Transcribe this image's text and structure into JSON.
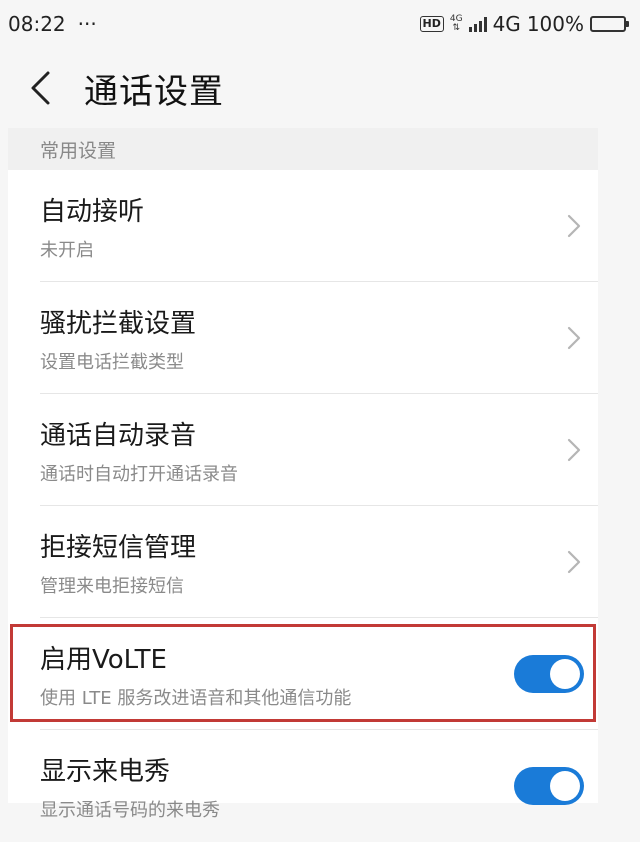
{
  "status_bar": {
    "time": "08:22",
    "dots": "···",
    "hd": "HD",
    "net_small": "4G",
    "net": "4G",
    "battery": "100%"
  },
  "header": {
    "title": "通话设置",
    "back_icon": "chevron-left-icon"
  },
  "section": {
    "label": "常用设置"
  },
  "items": [
    {
      "title": "自动接听",
      "subtitle": "未开启",
      "control": "chevron"
    },
    {
      "title": "骚扰拦截设置",
      "subtitle": "设置电话拦截类型",
      "control": "chevron"
    },
    {
      "title": "通话自动录音",
      "subtitle": "通话时自动打开通话录音",
      "control": "chevron"
    },
    {
      "title": "拒接短信管理",
      "subtitle": "管理来电拒接短信",
      "control": "chevron"
    },
    {
      "title": "启用VoLTE",
      "subtitle": "使用 LTE 服务改进语音和其他通信功能",
      "control": "toggle",
      "on": true
    },
    {
      "title": "显示来电秀",
      "subtitle": "显示通话号码的来电秀",
      "control": "toggle",
      "on": true
    }
  ],
  "colors": {
    "accent": "#1a7bd8",
    "highlight": "#c23a36"
  }
}
